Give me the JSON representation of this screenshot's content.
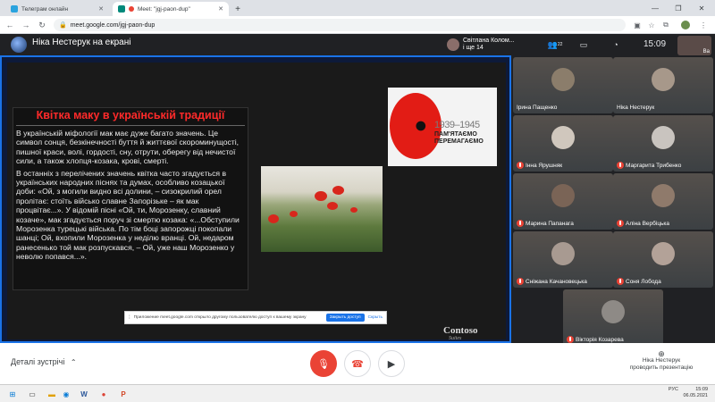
{
  "browser": {
    "tabs": [
      {
        "label": "Телеграм онлайн",
        "active": false
      },
      {
        "label": "Meet: \"jgj-paon-dup\"",
        "active": true
      }
    ],
    "new_tab": "+",
    "url": "meet.google.com/jgj-paon-dup",
    "window_controls": {
      "minimize": "—",
      "maximize": "❐",
      "close": "✕"
    }
  },
  "meet": {
    "presenting_label": "Ніка Нестерук на екрані",
    "participants_summary": {
      "name": "Світлана Колом...",
      "more": "і ще 14"
    },
    "clock": "15:09",
    "self_label": "Ва",
    "header_icon_badge": "22"
  },
  "slide": {
    "title": "Квітка маку в українській традиції",
    "paragraph1": "В українській міфології мак має дуже багато значень. Це символ сонця, безкінечності буття й життєвої скороминущості, пишної краси, волі, гордості, сну, отрути, оберегу від нечистої сили, а також хлопця-козака, крові, смерті.",
    "paragraph2": "В останніх з перелічених значень квітка часто згадується в українських народних піснях та думах, особливо козацької доби: «Ой, з могили видно всі долини, – сизокрилий орел пролітає: стоїть військо славне Запорізьке – як мак процвітає...». У відомій пісні «Ой, ти, Морозенку, славний козаче», мак згадується поруч зі смертю козака: «...Обступили Морозенка турецькі війська. По тім боці запорожці покопали шанці; Ой, вхопили Морозенка у неділю вранці. Ой, недаром ранесенько той мак розпускався, – Ой, уже наш Морозенко у неволю попався...».",
    "poster_years": "1939–1945",
    "poster_line1": "ПАМ'ЯТАЄМО",
    "poster_line2": "ПЕРЕМАГАЄМО",
    "brand": "Contoso",
    "brand_sub": "Suites"
  },
  "sharebar": {
    "text": "Приложение meet.google.com открыло другому пользователю доступ к вашему экрану",
    "stop_button": "Закрыть доступ",
    "hide_link": "Скрыть"
  },
  "participants": [
    {
      "name": "Ірина Пащенко",
      "muted": false,
      "color": "#8b7d6b"
    },
    {
      "name": "Ніка Нестерук",
      "muted": false,
      "color": "#a7988a"
    },
    {
      "name": "Інна Ярушняк",
      "muted": true,
      "color": "#d0c7bd"
    },
    {
      "name": "Маргарита Трибенко",
      "muted": true,
      "color": "#c9c4bf"
    },
    {
      "name": "Марина Папанага",
      "muted": true,
      "color": "#7a6456"
    },
    {
      "name": "Аліна Вербіцька",
      "muted": true,
      "color": "#8f7a6b"
    },
    {
      "name": "Сніжана Качановецька",
      "muted": true,
      "color": "#a89a91"
    },
    {
      "name": "Соня Лобода",
      "muted": true,
      "color": "#b3a298"
    },
    {
      "name": "Вікторія Козарева",
      "muted": true,
      "color": "#8e8a86"
    }
  ],
  "bottombar": {
    "details_label": "Деталі зустрічі",
    "presenter_line1": "Ніка Нестерук",
    "presenter_line2": "проводить презентацію"
  },
  "taskbar": {
    "time": "15:09",
    "date": "06.05.2021",
    "lang": "РУС"
  },
  "colors": {
    "accent": "#1a73e8",
    "end_call": "#ea4335",
    "slide_title": "#ff2a2a"
  }
}
